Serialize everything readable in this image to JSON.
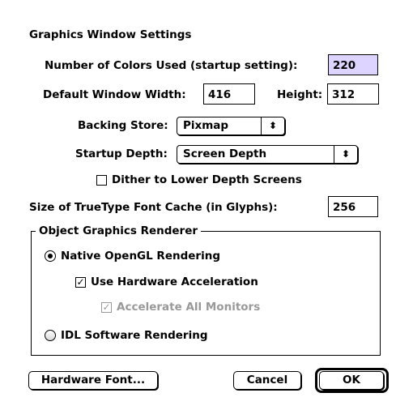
{
  "dialog": {
    "title": "Graphics Window Settings"
  },
  "colors": {
    "label": "Number of Colors Used (startup setting):",
    "value": "220",
    "highlight": "#ddd5ff"
  },
  "window_size": {
    "width_label": "Default Window Width:",
    "width_value": "416",
    "height_label": "Height:",
    "height_value": "312"
  },
  "backing_store": {
    "label": "Backing Store:",
    "selected": "Pixmap"
  },
  "startup_depth": {
    "label": "Startup Depth:",
    "selected": "Screen Depth"
  },
  "dither": {
    "label": "Dither to Lower Depth Screens",
    "checked": false
  },
  "font_cache": {
    "label": "Size of TrueType Font Cache (in Glyphs):",
    "value": "256"
  },
  "renderer_group": {
    "title": "Object Graphics Renderer",
    "native_label": "Native OpenGL Rendering",
    "native_selected": true,
    "hw_accel_label": "Use Hardware Acceleration",
    "hw_accel_checked": true,
    "accel_all_label": "Accelerate All Monitors",
    "accel_all_checked": true,
    "accel_all_enabled": false,
    "software_label": "IDL Software Rendering",
    "software_selected": false
  },
  "buttons": {
    "hardware_font": "Hardware Font...",
    "cancel": "Cancel",
    "ok": "OK"
  },
  "icons": {
    "popup_arrows": "up-down-arrows-icon",
    "check_mark": "check-mark-icon"
  },
  "glyphs": {
    "updown": "⬍",
    "check": "✓"
  }
}
